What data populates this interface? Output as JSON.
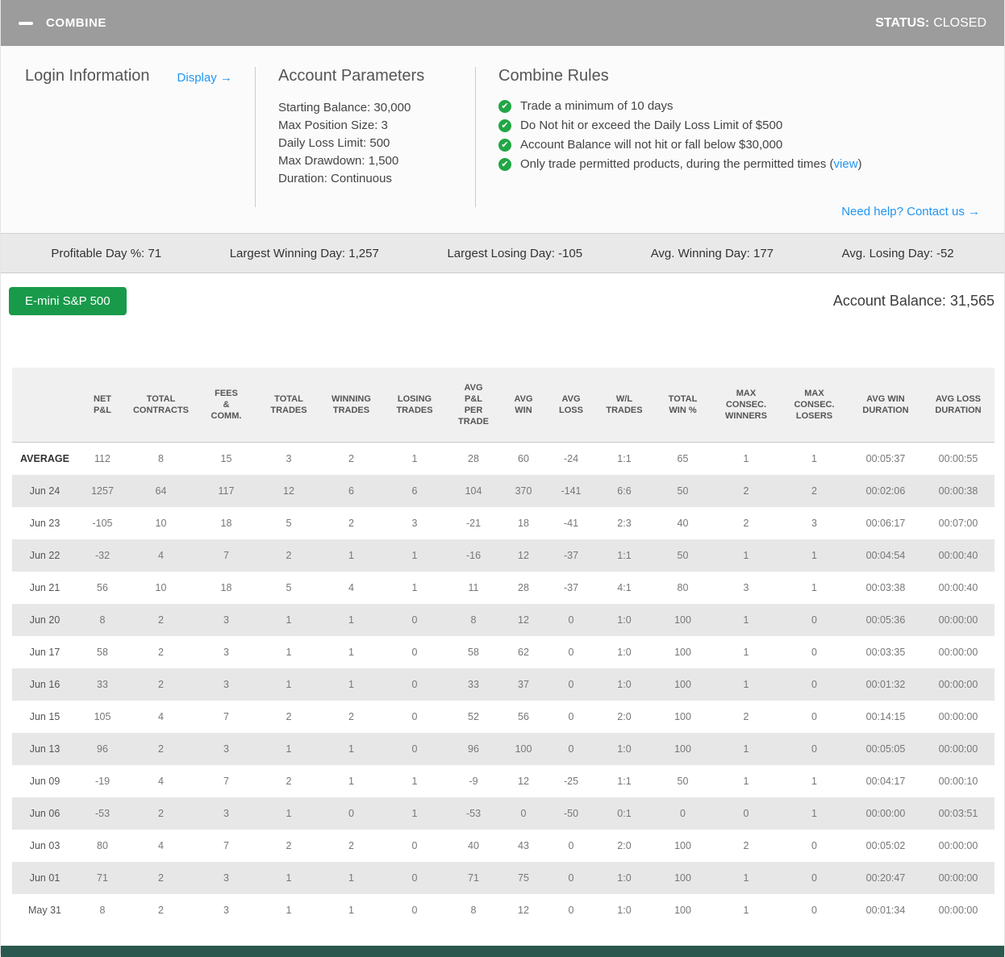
{
  "header": {
    "title": "COMBINE",
    "status_label": "STATUS:",
    "status_value": "CLOSED"
  },
  "info": {
    "login_title": "Login Information",
    "display_link": "Display →",
    "params_title": "Account Parameters",
    "params": [
      "Starting Balance: 30,000",
      "Max Position Size: 3",
      "Daily Loss Limit: 500",
      "Max Drawdown: 1,500",
      "Duration: Continuous"
    ],
    "rules_title": "Combine Rules",
    "rules": [
      {
        "text": "Trade a minimum of 10 days"
      },
      {
        "text": "Do Not hit or exceed the Daily Loss Limit of $500"
      },
      {
        "text": "Account Balance will not hit or fall below $30,000"
      },
      {
        "text": "Only trade permitted products, during the permitted times (",
        "link": "view",
        "suffix": ")"
      }
    ],
    "help_link": "Need help? Contact us →"
  },
  "stats": [
    "Profitable Day %: 71",
    "Largest Winning Day: 1,257",
    "Largest Losing Day: -105",
    "Avg. Winning Day: 177",
    "Avg. Losing Day: -52"
  ],
  "instrument_button": "E-mini S&P 500",
  "account_balance": "Account Balance: 31,565",
  "colors": {
    "accent_green": "#189a4a",
    "check_green": "#21a645",
    "link_blue": "#2196f3",
    "header_gray": "#9c9c9c",
    "stripe_gray": "#e7e7e7"
  },
  "table": {
    "columns": [
      "",
      "NET\nP&L",
      "TOTAL\nCONTRACTS",
      "FEES\n&\nCOMM.",
      "TOTAL\nTRADES",
      "WINNING\nTRADES",
      "LOSING\nTRADES",
      "AVG\nP&L\nPER\nTRADE",
      "AVG\nWIN",
      "AVG\nLOSS",
      "W/L\nTRADES",
      "TOTAL\nWIN %",
      "MAX\nCONSEC.\nWINNERS",
      "MAX\nCONSEC.\nLOSERS",
      "AVG WIN\nDURATION",
      "AVG LOSS\nDURATION"
    ],
    "rows": [
      {
        "label": "AVERAGE",
        "bold": true,
        "values": [
          "112",
          "8",
          "15",
          "3",
          "2",
          "1",
          "28",
          "60",
          "-24",
          "1:1",
          "65",
          "1",
          "1",
          "00:05:37",
          "00:00:55"
        ]
      },
      {
        "label": "Jun 24",
        "bold": false,
        "values": [
          "1257",
          "64",
          "117",
          "12",
          "6",
          "6",
          "104",
          "370",
          "-141",
          "6:6",
          "50",
          "2",
          "2",
          "00:02:06",
          "00:00:38"
        ]
      },
      {
        "label": "Jun 23",
        "bold": false,
        "values": [
          "-105",
          "10",
          "18",
          "5",
          "2",
          "3",
          "-21",
          "18",
          "-41",
          "2:3",
          "40",
          "2",
          "3",
          "00:06:17",
          "00:07:00"
        ]
      },
      {
        "label": "Jun 22",
        "bold": false,
        "values": [
          "-32",
          "4",
          "7",
          "2",
          "1",
          "1",
          "-16",
          "12",
          "-37",
          "1:1",
          "50",
          "1",
          "1",
          "00:04:54",
          "00:00:40"
        ]
      },
      {
        "label": "Jun 21",
        "bold": false,
        "values": [
          "56",
          "10",
          "18",
          "5",
          "4",
          "1",
          "11",
          "28",
          "-37",
          "4:1",
          "80",
          "3",
          "1",
          "00:03:38",
          "00:00:40"
        ]
      },
      {
        "label": "Jun 20",
        "bold": false,
        "values": [
          "8",
          "2",
          "3",
          "1",
          "1",
          "0",
          "8",
          "12",
          "0",
          "1:0",
          "100",
          "1",
          "0",
          "00:05:36",
          "00:00:00"
        ]
      },
      {
        "label": "Jun 17",
        "bold": false,
        "values": [
          "58",
          "2",
          "3",
          "1",
          "1",
          "0",
          "58",
          "62",
          "0",
          "1:0",
          "100",
          "1",
          "0",
          "00:03:35",
          "00:00:00"
        ]
      },
      {
        "label": "Jun 16",
        "bold": false,
        "values": [
          "33",
          "2",
          "3",
          "1",
          "1",
          "0",
          "33",
          "37",
          "0",
          "1:0",
          "100",
          "1",
          "0",
          "00:01:32",
          "00:00:00"
        ]
      },
      {
        "label": "Jun 15",
        "bold": false,
        "values": [
          "105",
          "4",
          "7",
          "2",
          "2",
          "0",
          "52",
          "56",
          "0",
          "2:0",
          "100",
          "2",
          "0",
          "00:14:15",
          "00:00:00"
        ]
      },
      {
        "label": "Jun 13",
        "bold": false,
        "values": [
          "96",
          "2",
          "3",
          "1",
          "1",
          "0",
          "96",
          "100",
          "0",
          "1:0",
          "100",
          "1",
          "0",
          "00:05:05",
          "00:00:00"
        ]
      },
      {
        "label": "Jun 09",
        "bold": false,
        "values": [
          "-19",
          "4",
          "7",
          "2",
          "1",
          "1",
          "-9",
          "12",
          "-25",
          "1:1",
          "50",
          "1",
          "1",
          "00:04:17",
          "00:00:10"
        ]
      },
      {
        "label": "Jun 06",
        "bold": false,
        "values": [
          "-53",
          "2",
          "3",
          "1",
          "0",
          "1",
          "-53",
          "0",
          "-50",
          "0:1",
          "0",
          "0",
          "1",
          "00:00:00",
          "00:03:51"
        ]
      },
      {
        "label": "Jun 03",
        "bold": false,
        "values": [
          "80",
          "4",
          "7",
          "2",
          "2",
          "0",
          "40",
          "43",
          "0",
          "2:0",
          "100",
          "2",
          "0",
          "00:05:02",
          "00:00:00"
        ]
      },
      {
        "label": "Jun 01",
        "bold": false,
        "values": [
          "71",
          "2",
          "3",
          "1",
          "1",
          "0",
          "71",
          "75",
          "0",
          "1:0",
          "100",
          "1",
          "0",
          "00:20:47",
          "00:00:00"
        ]
      },
      {
        "label": "May 31",
        "bold": false,
        "values": [
          "8",
          "2",
          "3",
          "1",
          "1",
          "0",
          "8",
          "12",
          "0",
          "1:0",
          "100",
          "1",
          "0",
          "00:01:34",
          "00:00:00"
        ]
      }
    ]
  }
}
